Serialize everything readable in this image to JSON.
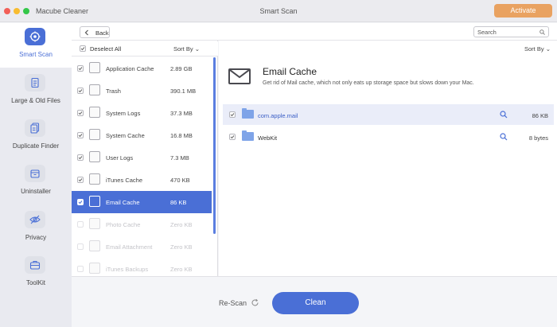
{
  "window": {
    "app_name": "Macube Cleaner",
    "title": "Smart Scan",
    "activate_label": "Activate",
    "accent": "#4a6fd6",
    "activate_color": "#e9a261"
  },
  "sidebar": {
    "items": [
      {
        "label": "Smart Scan",
        "icon": "target-icon",
        "active": true
      },
      {
        "label": "Large & Old Files",
        "icon": "document-icon",
        "active": false
      },
      {
        "label": "Duplicate Finder",
        "icon": "duplicate-icon",
        "active": false
      },
      {
        "label": "Uninstaller",
        "icon": "uninstall-icon",
        "active": false
      },
      {
        "label": "Privacy",
        "icon": "eye-slash-icon",
        "active": false
      },
      {
        "label": "ToolKit",
        "icon": "toolkit-icon",
        "active": false
      }
    ]
  },
  "toolbar": {
    "back_label": "Back",
    "search_placeholder": "Search"
  },
  "list": {
    "deselect_label": "Deselect All",
    "sort_label": "Sort By",
    "items": [
      {
        "name": "Application Cache",
        "size": "2.89 GB",
        "checked": true,
        "state": "normal"
      },
      {
        "name": "Trash",
        "size": "390.1 MB",
        "checked": true,
        "state": "normal"
      },
      {
        "name": "System Logs",
        "size": "37.3 MB",
        "checked": true,
        "state": "normal"
      },
      {
        "name": "System Cache",
        "size": "16.8 MB",
        "checked": true,
        "state": "normal"
      },
      {
        "name": "User Logs",
        "size": "7.3 MB",
        "checked": true,
        "state": "normal"
      },
      {
        "name": "iTunes Cache",
        "size": "470 KB",
        "checked": true,
        "state": "normal"
      },
      {
        "name": "Email Cache",
        "size": "86 KB",
        "checked": true,
        "state": "selected"
      },
      {
        "name": "Photo Cache",
        "size": "Zero KB",
        "checked": false,
        "state": "disabled"
      },
      {
        "name": "Email Attachment",
        "size": "Zero KB",
        "checked": false,
        "state": "disabled"
      },
      {
        "name": "iTunes Backups",
        "size": "Zero KB",
        "checked": false,
        "state": "disabled"
      }
    ]
  },
  "detail": {
    "sort_label": "Sort By",
    "title": "Email Cache",
    "description": "Get rid of Mail cache, which not only eats up storage space but slows down your Mac.",
    "files": [
      {
        "name": "com.apple.mail",
        "size": "86 KB",
        "checked": true
      },
      {
        "name": "WebKit",
        "size": "8 bytes",
        "checked": true
      }
    ]
  },
  "footer": {
    "rescan_label": "Re-Scan",
    "clean_label": "Clean"
  }
}
